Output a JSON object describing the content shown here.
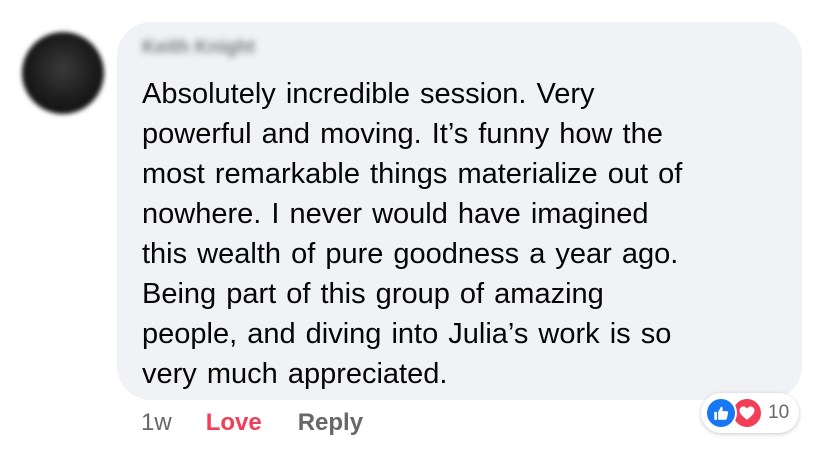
{
  "comment": {
    "author": "Keith Knight",
    "text": "Absolutely  incredible  session. Very\npowerful  and  moving. It’s funny  how the\nmost  remarkable things  materialize out  of\nnowhere. I  never  would  have  imagined\nthis wealth  of  pure  goodness  a  year  ago.\nBeing  part  of  this  group of amazing\npeople,  and  diving into Julia’s  work  is  so\nvery  much  appreciated."
  },
  "actions": {
    "timestamp": "1w",
    "love_label": "Love",
    "reply_label": "Reply"
  },
  "reactions": {
    "icons": [
      "like-icon",
      "love-icon"
    ],
    "count": "10"
  },
  "colors": {
    "bubble": "#f0f2f5",
    "love": "#f33e58",
    "like": "#1877f2",
    "secondary_text": "#65676b"
  }
}
